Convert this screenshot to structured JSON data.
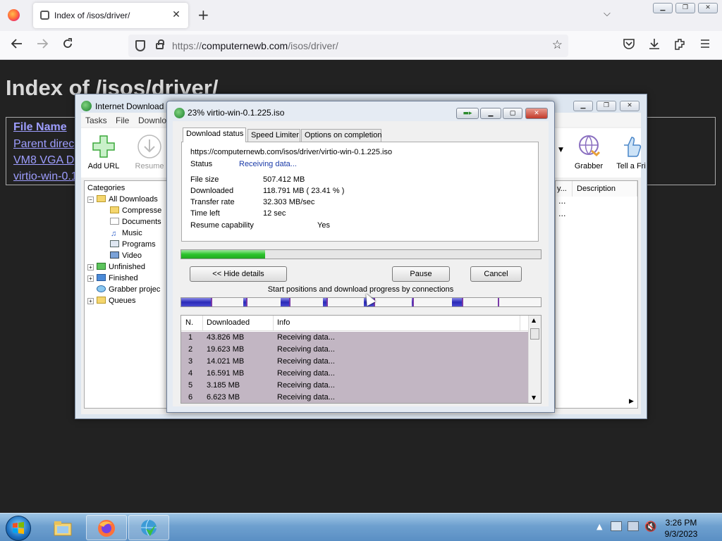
{
  "browser": {
    "tab_title": "Index of /isos/driver/",
    "tab_close": "✕",
    "new_tab": "+",
    "tablist": "⌵",
    "url_base": "https://",
    "url_domain": "computernewb.com",
    "url_path": "/isos/driver/",
    "controls": {
      "minimize": "▁",
      "maximize": "❐",
      "close": "✕"
    }
  },
  "page": {
    "heading": "Index of /isos/driver/",
    "links": [
      "File Name",
      "Parent direc",
      "VM8 VGA D",
      "virtio-win-0.1"
    ]
  },
  "idm_main": {
    "title": "Internet Download",
    "menu": [
      "Tasks",
      "File",
      "Downlo"
    ],
    "toolbar": {
      "add_url": "Add URL",
      "resume": "Resume",
      "grabber": "Grabber",
      "tell_friend": "Tell a Fri"
    },
    "categories_header": "Categories",
    "categories": [
      {
        "label": "All Downloads",
        "level": 1,
        "expander": "−"
      },
      {
        "label": "Compresse",
        "level": 2
      },
      {
        "label": "Documents",
        "level": 2
      },
      {
        "label": "Music",
        "level": 2
      },
      {
        "label": "Programs",
        "level": 2
      },
      {
        "label": "Video",
        "level": 2
      },
      {
        "label": "Unfinished",
        "level": 1,
        "expander": "+"
      },
      {
        "label": "Finished",
        "level": 1,
        "expander": "+"
      },
      {
        "label": "Grabber projec",
        "level": 1
      },
      {
        "label": "Queues",
        "level": 1,
        "expander": "+"
      }
    ],
    "list_columns": [
      "y...",
      "Description"
    ],
    "list_ellipsis": [
      "...",
      "..."
    ]
  },
  "dialog": {
    "title": "23% virtio-win-0.1.225.iso",
    "tabs": [
      "Download status",
      "Speed Limiter",
      "Options on completion"
    ],
    "url": "https://computernewb.com/isos/driver/virtio-win-0.1.225.iso",
    "status_label": "Status",
    "status_value": "Receiving data...",
    "file_size_label": "File size",
    "file_size_value": "507.412  MB",
    "downloaded_label": "Downloaded",
    "downloaded_value": "118.791  MB  ( 23.41 % )",
    "transfer_rate_label": "Transfer rate",
    "transfer_rate_value": "32.303  MB/sec",
    "time_left_label": "Time left",
    "time_left_value": "12 sec",
    "resume_label": "Resume capability",
    "resume_value": "Yes",
    "progress_percent": 23.41,
    "hide_details": "<< Hide details",
    "pause": "Pause",
    "cancel": "Cancel",
    "connections_caption": "Start positions and download progress by connections",
    "connection_segments": [
      {
        "start": 0.0,
        "progress": 0.087
      },
      {
        "start": 0.173,
        "progress": 0.012
      },
      {
        "start": 0.277,
        "progress": 0.027
      },
      {
        "start": 0.395,
        "progress": 0.012
      },
      {
        "start": 0.507,
        "progress": 0.033
      },
      {
        "start": 0.641,
        "progress": 0.006
      },
      {
        "start": 0.752,
        "progress": 0.033
      },
      {
        "start": 0.88,
        "progress": 0.004
      }
    ],
    "table_headers": [
      "N.",
      "Downloaded",
      "Info"
    ],
    "rows": [
      {
        "n": "1",
        "downloaded": "43.826  MB",
        "info": "Receiving data..."
      },
      {
        "n": "2",
        "downloaded": "19.623  MB",
        "info": "Receiving data..."
      },
      {
        "n": "3",
        "downloaded": "14.021  MB",
        "info": "Receiving data..."
      },
      {
        "n": "4",
        "downloaded": "16.591  MB",
        "info": "Receiving data..."
      },
      {
        "n": "5",
        "downloaded": "3.185  MB",
        "info": "Receiving data..."
      },
      {
        "n": "6",
        "downloaded": "6.623  MB",
        "info": "Receiving data..."
      }
    ]
  },
  "taskbar": {
    "time": "3:26 PM",
    "date": "9/3/2023",
    "show_hidden": "▲"
  },
  "colors": {
    "page_bg": "#222222",
    "link": "#9e9eff",
    "progress_green": "#2cc42c",
    "connection_blue": "#2a2ab8",
    "row_bg": "#c2b6c3"
  }
}
